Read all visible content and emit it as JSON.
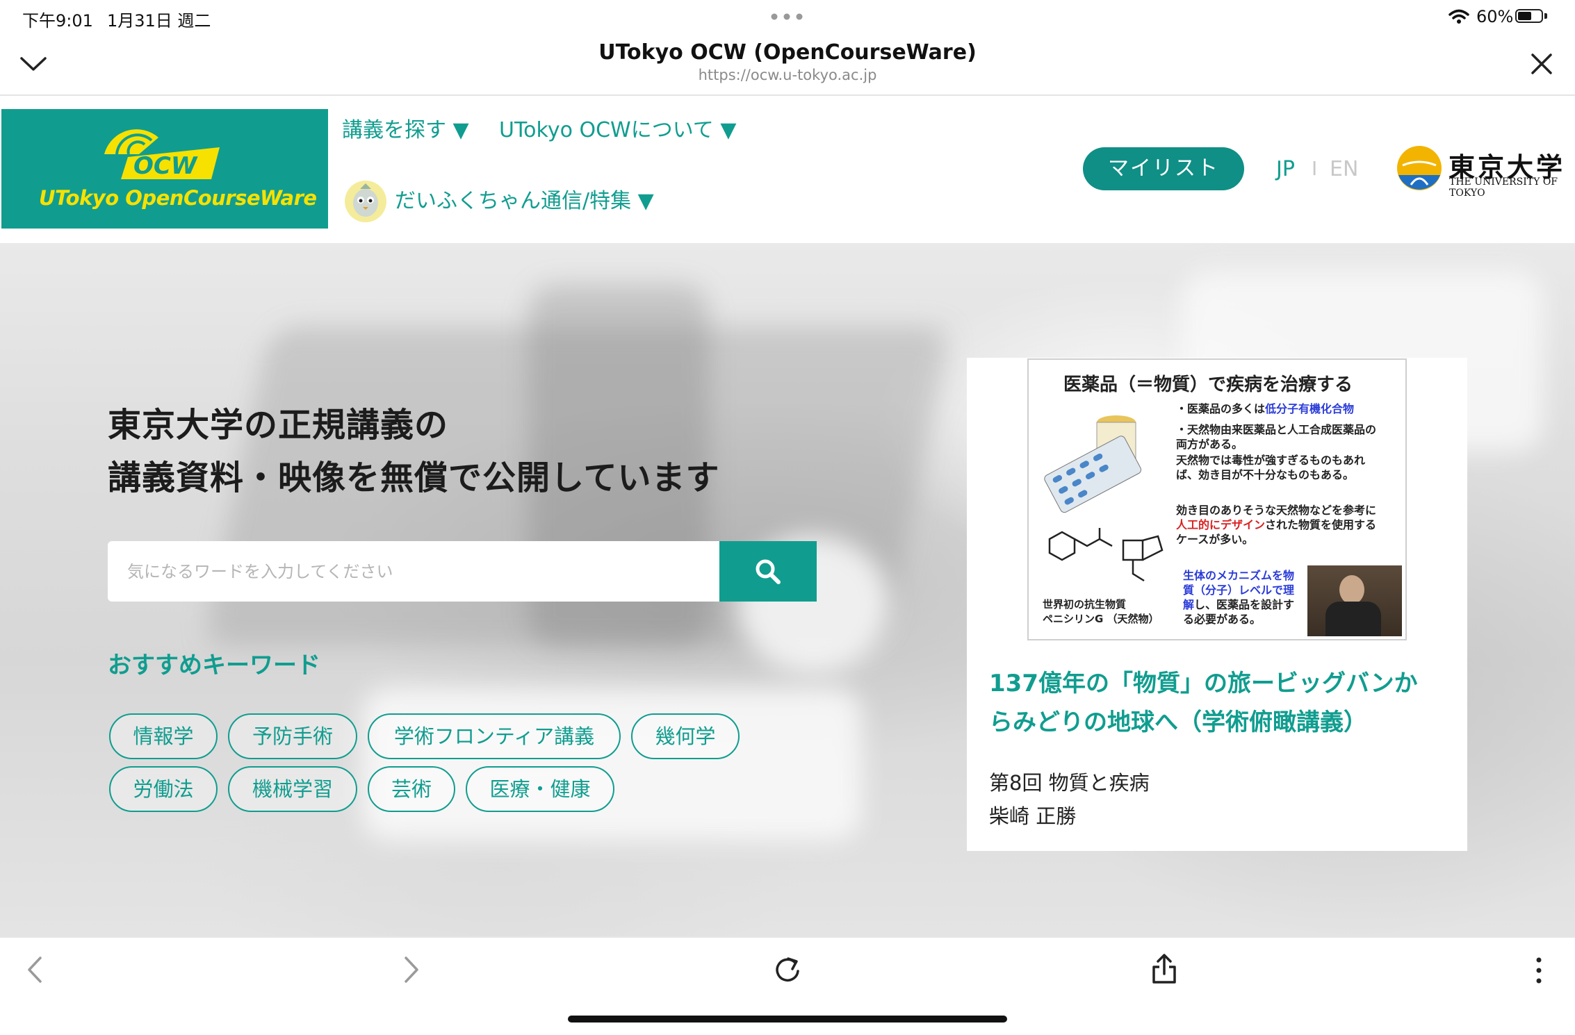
{
  "status": {
    "time": "下午9:01",
    "date": "1月31日 週二",
    "battery": "60%",
    "battery_level": 0.6
  },
  "browser": {
    "title": "UTokyo OCW (OpenCourseWare)",
    "url": "https://ocw.u-tokyo.ac.jp"
  },
  "header": {
    "logo_text": "UTokyo OpenCourseWare",
    "logo_mark": "OCW",
    "nav": {
      "find_courses": "講義を探す ▼",
      "about": "UTokyo OCWについて ▼",
      "daifuku": "だいふくちゃん通信/特集 ▼"
    },
    "mylist": "マイリスト",
    "lang_jp": "JP",
    "lang_sep": "I",
    "lang_en": "EN",
    "university_jp": "東京大学",
    "university_en": "THE UNIVERSITY OF TOKYO"
  },
  "hero": {
    "headline_line1": "東京大学の正規講義の",
    "headline_line2": "講義資料・映像を無償で公開しています",
    "search_placeholder": "気になるワードを入力してください",
    "keywords_heading": "おすすめキーワード",
    "keywords": [
      "情報学",
      "予防手術",
      "学術フロンティア講義",
      "幾何学",
      "労働法",
      "機械学習",
      "芸術",
      "医療・健康"
    ]
  },
  "featured": {
    "slide": {
      "title": "医薬品（＝物質）で疾病を治療する",
      "bullet1_a": "・医薬品の多くは",
      "bullet1_b": "低分子有機化合物",
      "bullet2": "・天然物由来医薬品と人工合成医薬品の両方がある。",
      "note1": "天然物では毒性が強すぎるものもあれば、効き目が不十分なものもある。",
      "note2_a": "効き目のありそうな天然物などを参考に",
      "note2_b": "人工的にデザイン",
      "note2_c": "された物質を使用するケースが多い。",
      "note3_a": "生体のメカニズムを物質（分子）レベルで理解",
      "note3_b": "し、医薬品を設計する必要がある。",
      "caption1": "世界初の抗生物質",
      "caption2": "ペニシリンG （天然物）"
    },
    "course_title_line1": "137億年の「物質」の旅ービッグバンか",
    "course_title_line2": "らみどりの地球へ（学術俯瞰講義）",
    "lecture": "第8回 物質と疾病",
    "lecturer": "柴崎 正勝"
  },
  "colors": {
    "accent": "#109d8f",
    "logo_yellow": "#f7e100",
    "mylist_bg": "#0f8f86"
  },
  "icons": [
    "chevron-down-icon",
    "close-icon",
    "search-icon",
    "back-icon",
    "forward-icon",
    "reload-icon",
    "share-icon",
    "more-icon",
    "wifi-icon",
    "battery-icon"
  ]
}
